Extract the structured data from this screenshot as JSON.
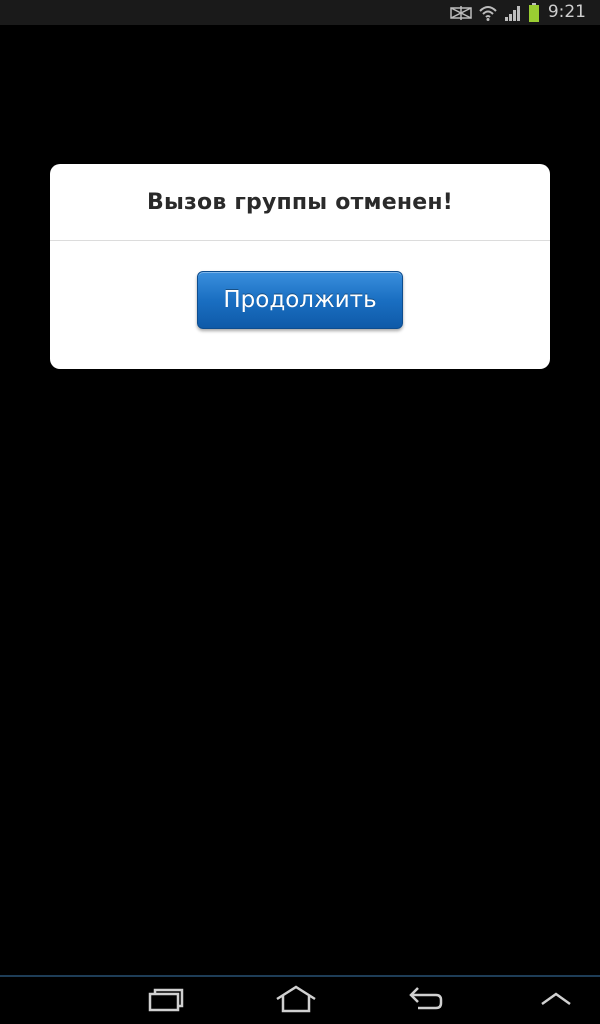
{
  "status_bar": {
    "time": "9:21",
    "icons": [
      "signal-blocked-icon",
      "wifi-icon",
      "cell-signal-icon",
      "battery-icon"
    ],
    "battery_color": "#9acd32"
  },
  "dialog": {
    "title": "Вызов группы отменен!",
    "button_label": "Продолжить"
  },
  "nav_bar": {
    "buttons": [
      "recent-apps-icon",
      "home-icon",
      "back-icon",
      "menu-up-icon"
    ]
  },
  "colors": {
    "background": "#000000",
    "dialog": "#ffffff",
    "button": "#1a6fc2",
    "nav_border": "#1e3d57"
  }
}
